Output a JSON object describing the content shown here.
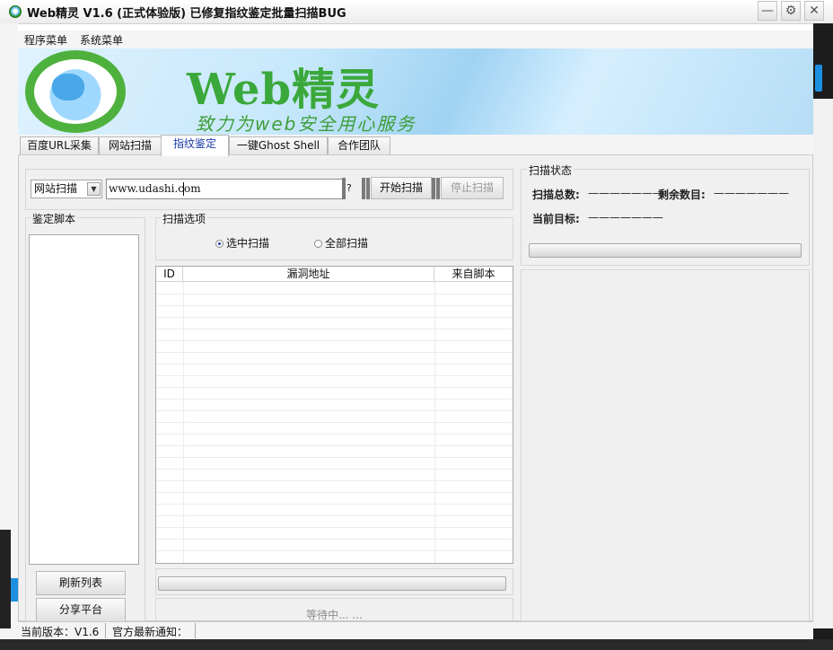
{
  "window": {
    "title": "Web精灵 V1.6 (正式体验版) 已修复指纹鉴定批量扫描BUG",
    "minimize_glyph": "—",
    "options_glyph": "⚙",
    "close_glyph": "✕"
  },
  "menu": {
    "items": [
      {
        "label": "程序菜单"
      },
      {
        "label": "系统菜单"
      }
    ]
  },
  "banner": {
    "title": "Web精灵",
    "slogan": "致力为web安全用心服务"
  },
  "tabs": [
    {
      "label": "百度URL采集"
    },
    {
      "label": "网站扫描"
    },
    {
      "label": "指纹鉴定"
    },
    {
      "label": "一键Ghost Shell"
    },
    {
      "label": "合作团队"
    }
  ],
  "active_tab": "指纹鉴定",
  "scan_bar": {
    "mode_selected": "网站扫描",
    "url_value": "www.udashi.com",
    "help_label": "?",
    "start_label": "开始扫描",
    "stop_label": "停止扫描"
  },
  "scripts_group": {
    "title": "鉴定脚本",
    "refresh_label": "刷新列表",
    "share_label": "分享平台"
  },
  "scan_options": {
    "title": "扫描选项",
    "option_selected": "选中扫描",
    "option_all": "全部扫描",
    "selected_checked": true
  },
  "results_table": {
    "columns": [
      "ID",
      "漏洞地址",
      "来自脚本"
    ],
    "rows": []
  },
  "waiting_text": "等待中... ...",
  "scan_status": {
    "title": "扫描状态",
    "total_label": "扫描总数:",
    "total_value": "———————",
    "remaining_label": "剩余数目:",
    "remaining_value": "———————",
    "current_label": "当前目标:",
    "current_value": "———————"
  },
  "statusbar": {
    "version": "当前版本：V1.6",
    "notice": "官方最新通知："
  },
  "colors": {
    "accent_tab_text": "#1a3aa8",
    "brand_green": "#3aa83a",
    "chrome_blue": "#1d8fe0"
  }
}
